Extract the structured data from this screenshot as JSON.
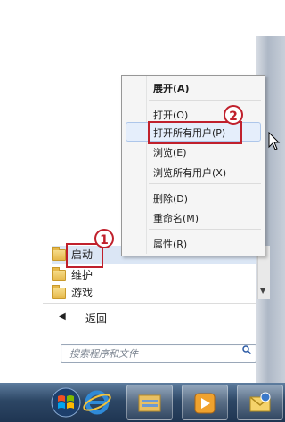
{
  "start_menu": {
    "programs": [
      {
        "label": "启动",
        "icon": "folder-icon"
      },
      {
        "label": "维护",
        "icon": "folder-icon"
      },
      {
        "label": "游戏",
        "icon": "folder-icon"
      }
    ],
    "back_label": "返回",
    "search_placeholder": "搜索程序和文件"
  },
  "context_menu": {
    "items": [
      {
        "label": "展开(A)",
        "bold": true
      },
      {
        "label": "打开(O)"
      },
      {
        "label": "打开所有用户(P)"
      },
      {
        "label": "浏览(E)"
      },
      {
        "label": "浏览所有用户(X)"
      },
      {
        "label": "删除(D)"
      },
      {
        "label": "重命名(M)"
      },
      {
        "label": "属性(R)"
      }
    ]
  },
  "annotations": {
    "step1": "1",
    "step2": "2",
    "color": "#c0202c"
  },
  "taskbar": {
    "buttons": [
      "windows-start-orb",
      "internet-explorer-icon",
      "file-explorer-icon",
      "media-player-icon",
      "outlook-icon"
    ]
  }
}
